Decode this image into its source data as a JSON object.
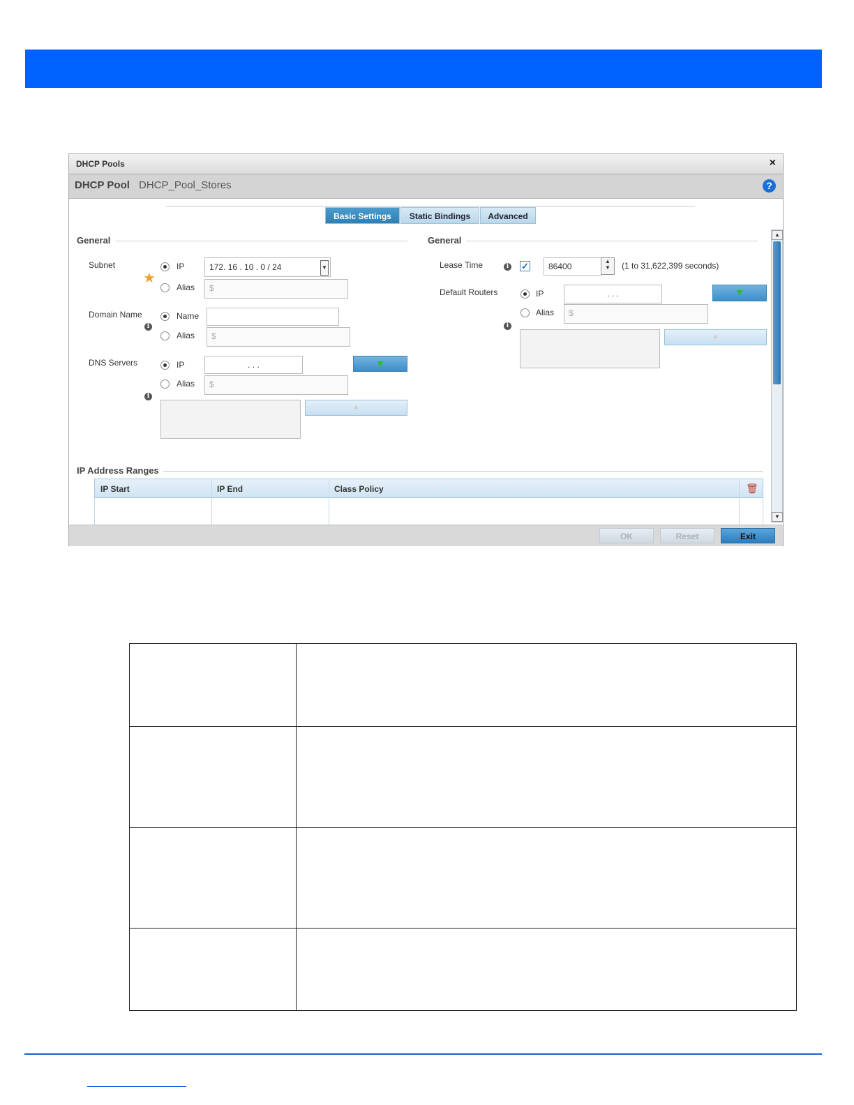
{
  "dialog": {
    "title": "DHCP Pools",
    "close_label": "×",
    "subheader_label": "DHCP Pool",
    "pool_name": "DHCP_Pool_Stores",
    "help_label": "?"
  },
  "tabs": [
    {
      "label": "Basic Settings",
      "active": true
    },
    {
      "label": "Static Bindings",
      "active": false
    },
    {
      "label": "Advanced",
      "active": false
    }
  ],
  "left_general": {
    "section_title": "General",
    "subnet": {
      "label": "Subnet",
      "ip_option": "IP",
      "alias_option": "Alias",
      "ip_value": "172.  16 .  10 .   0  /   24",
      "alias_placeholder": "$",
      "selected": "IP"
    },
    "domain_name": {
      "label": "Domain Name",
      "name_option": "Name",
      "alias_option": "Alias",
      "name_value": "",
      "alias_placeholder": "$",
      "selected": "Name"
    },
    "dns_servers": {
      "label": "DNS Servers",
      "ip_option": "IP",
      "alias_option": "Alias",
      "ip_value": ".     .     .",
      "alias_placeholder": "$",
      "selected": "IP"
    }
  },
  "right_general": {
    "section_title": "General",
    "lease_time": {
      "label": "Lease Time",
      "checked": true,
      "value": "86400",
      "range_hint": "(1 to 31,622,399 seconds)"
    },
    "default_routers": {
      "label": "Default Routers",
      "ip_option": "IP",
      "alias_option": "Alias",
      "ip_value": ".     .     .",
      "alias_placeholder": "$",
      "selected": "IP"
    }
  },
  "ip_ranges": {
    "section_title": "IP Address Ranges",
    "columns": [
      "IP Start",
      "IP End",
      "Class Policy"
    ]
  },
  "footer": {
    "ok_label": "OK",
    "reset_label": "Reset",
    "exit_label": "Exit"
  },
  "icons": {
    "add": "green-down-arrow-icon",
    "remove": "up-arrow-icon",
    "delete": "trash-icon",
    "info": "info-icon",
    "required": "required-star-icon"
  },
  "colors": {
    "header_band": "#0062ff",
    "tab_active": "#3a8dc1",
    "exit_button": "#2c7cbf",
    "required_star": "#f0a030",
    "delete_icon": "#c0392b"
  }
}
